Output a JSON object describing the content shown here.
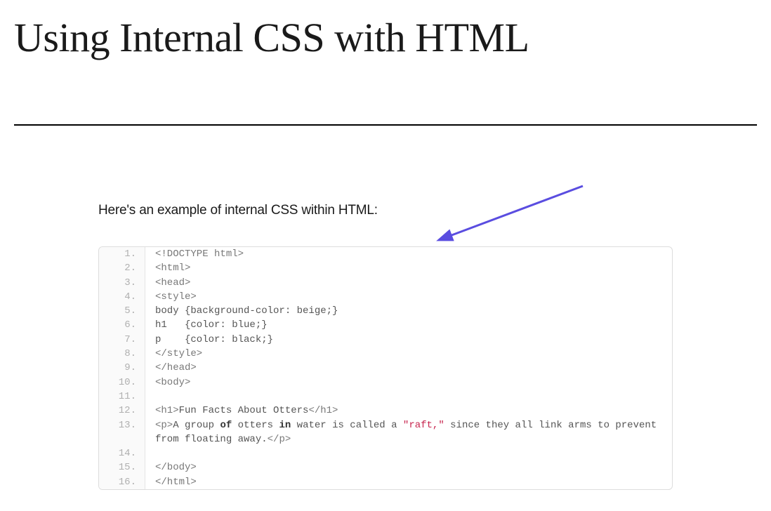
{
  "page": {
    "title": "Using Internal CSS with HTML",
    "intro": "Here's an example of internal CSS within HTML:"
  },
  "code": {
    "lines": [
      {
        "n": "1.",
        "raw": "<!DOCTYPE html>"
      },
      {
        "n": "2.",
        "raw": "<html>"
      },
      {
        "n": "3.",
        "raw": "<head>"
      },
      {
        "n": "4.",
        "raw": "<style>"
      },
      {
        "n": "5.",
        "raw": "body {background-color: beige;}"
      },
      {
        "n": "6.",
        "raw": "h1   {color: blue;}"
      },
      {
        "n": "7.",
        "raw": "p    {color: black;}"
      },
      {
        "n": "8.",
        "raw": "</style>"
      },
      {
        "n": "9.",
        "raw": "</head>"
      },
      {
        "n": "10.",
        "raw": "<body>"
      },
      {
        "n": "11.",
        "raw": ""
      },
      {
        "n": "12.",
        "raw": "<h1>Fun Facts About Otters</h1>"
      },
      {
        "n": "13.",
        "raw": "<p>A group of otters in water is called a \"raft,\" since they all link arms to prevent from floating away.</p>"
      },
      {
        "n": "14.",
        "raw": ""
      },
      {
        "n": "15.",
        "raw": "</body>"
      },
      {
        "n": "16.",
        "raw": "</html>"
      }
    ],
    "highlight_line": 13,
    "highlights": {
      "of": "of",
      "in": "in",
      "raft": "\"raft,\""
    }
  },
  "colors": {
    "arrow": "#5a4de0"
  }
}
